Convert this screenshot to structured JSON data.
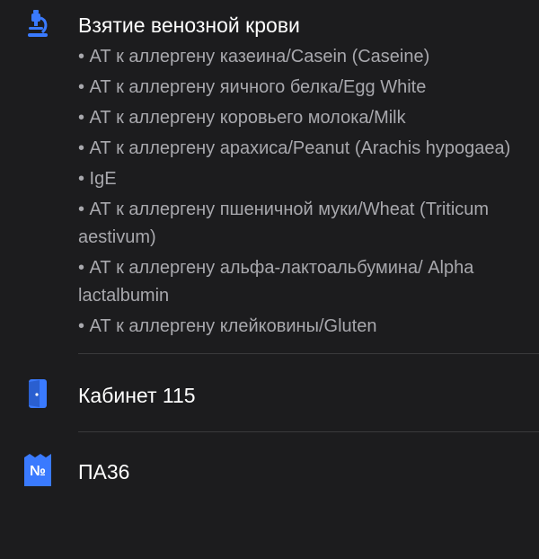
{
  "procedure": {
    "icon": "microscope-icon",
    "title": "Взятие венозной крови",
    "tests": [
      "• АТ к аллергену казеина/Casein (Caseine)",
      "• АТ к аллергену яичного белка/Egg White",
      "• АТ к аллергену коровьего молока/Milk",
      "• АТ к аллергену арахиса/Peanut (Arachis hypogaea)",
      "• IgE",
      "• АТ к аллергену пшеничной муки/Wheat (Triticum aestivum)",
      "• АТ к аллергену альфа-лактоальбумина/ Alpha lactalbumin",
      "• АТ к аллергену клейковины/Gluten"
    ]
  },
  "room": {
    "icon": "door-icon",
    "label": "Кабинет 115"
  },
  "code": {
    "icon": "number-badge-icon",
    "badge_text": "№",
    "label": "ПА36"
  },
  "colors": {
    "background": "#1c1c1e",
    "accent": "#3a7afe",
    "primary_text": "#ffffff",
    "secondary_text": "#a8a8ad",
    "divider": "#3a3a3c"
  }
}
